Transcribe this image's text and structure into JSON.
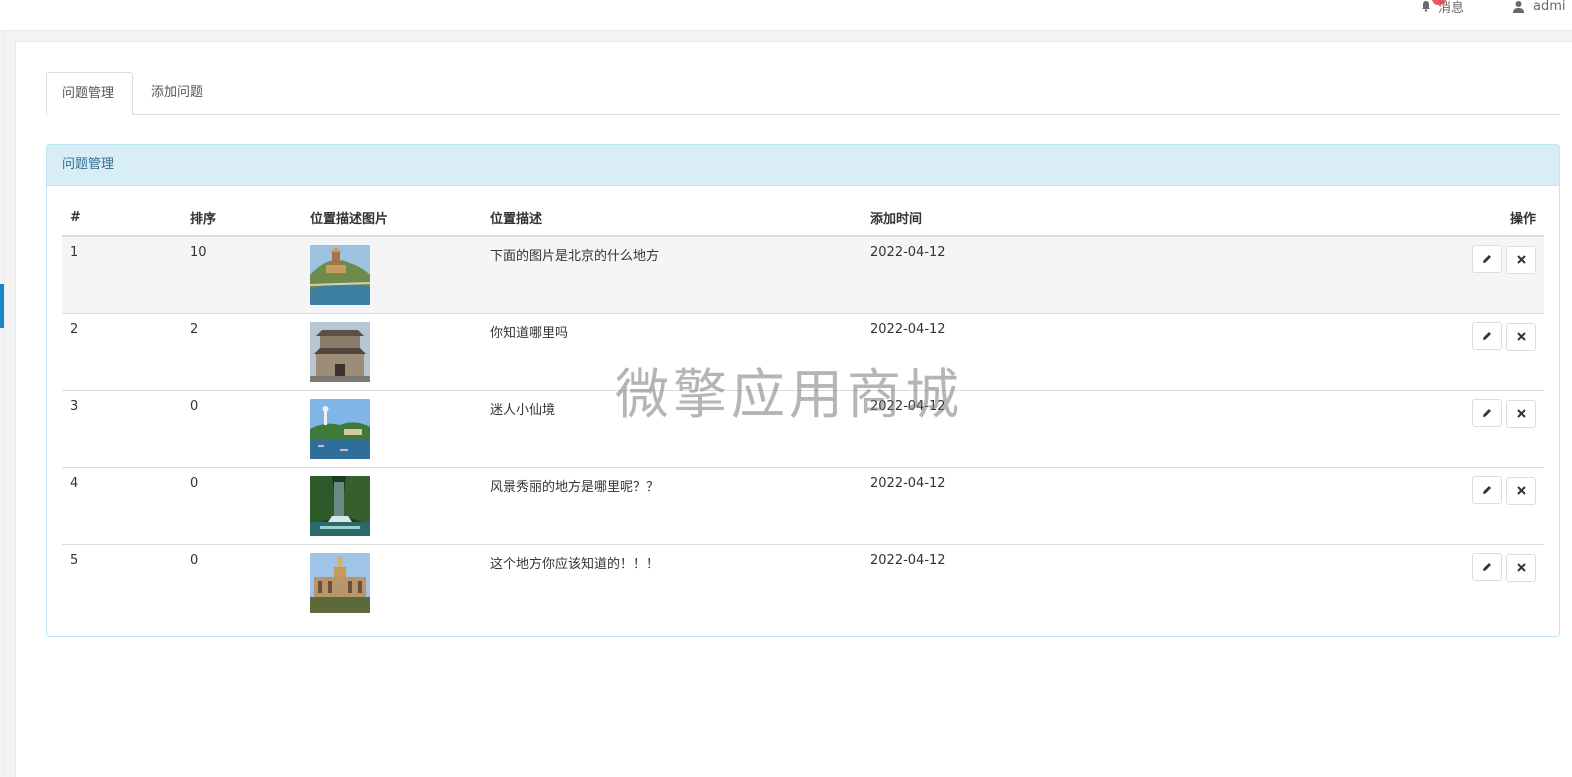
{
  "topbar": {
    "messages_label": "消息",
    "user_label": "admi"
  },
  "tabs": [
    {
      "label": "问题管理",
      "active": true
    },
    {
      "label": "添加问题",
      "active": false
    }
  ],
  "panel": {
    "title": "问题管理"
  },
  "table": {
    "headers": {
      "num": "#",
      "sort": "排序",
      "image": "位置描述图片",
      "desc": "位置描述",
      "time": "添加时间",
      "ops": "操作"
    },
    "rows": [
      {
        "num": "1",
        "sort": "10",
        "desc": "下面的图片是北京的什么地方",
        "time": "2022-04-12",
        "image": "pagoda-hill-photo"
      },
      {
        "num": "2",
        "sort": "2",
        "desc": "你知道哪里吗",
        "time": "2022-04-12",
        "image": "gate-tower-photo"
      },
      {
        "num": "3",
        "sort": "0",
        "desc": "迷人小仙境",
        "time": "2022-04-12",
        "image": "lake-pagoda-photo"
      },
      {
        "num": "4",
        "sort": "0",
        "desc": "风景秀丽的地方是哪里呢？？",
        "time": "2022-04-12",
        "image": "waterfall-photo"
      },
      {
        "num": "5",
        "sort": "0",
        "desc": "这个地方你应该知道的！！！",
        "time": "2022-04-12",
        "image": "exhibition-hall-photo"
      }
    ]
  },
  "icons": {
    "edit": "pencil-icon",
    "delete": "close-icon",
    "bell": "bell-icon",
    "user": "user-icon"
  },
  "watermark": "微擎应用商城",
  "colors": {
    "panel_heading_bg": "#d9edf7",
    "panel_border": "#bce8f1",
    "panel_title": "#31708f",
    "badge": "#ed5565"
  }
}
